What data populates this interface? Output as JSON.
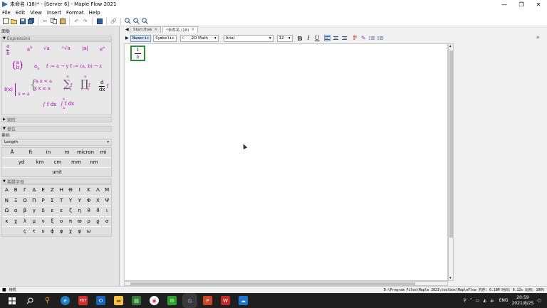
{
  "window": {
    "title": "未命名 (18)* - [Server 6] - Maple Flow 2021",
    "minimize": "—",
    "maximize": "❐",
    "close": "✕"
  },
  "menu": [
    "File",
    "Edit",
    "View",
    "Insert",
    "Format",
    "Help"
  ],
  "left_panel": {
    "header": "面板",
    "expression_title": "Expression",
    "expressions": {
      "frac_num": "a",
      "frac_den": "b",
      "power": "a",
      "power_sup": "b",
      "sqrt": "√a",
      "nroot": "ⁿ√a",
      "abs": "|a|",
      "exp": "e",
      "exp_sup": "a",
      "binom_top": "a",
      "binom_bot": "b",
      "subscript": "a",
      "subscript_sub": "n",
      "func_def": "f := a → y  f := (a, b) → z",
      "func_call": "f(x)",
      "eval_bar": "x = a",
      "piecewise_1": "-x   x < a",
      "piecewise_2": "x    x ≥ a",
      "sum": "∑",
      "sum_top": "n",
      "sum_bot": "i = k",
      "sum_body": "f",
      "prod": "∏",
      "prod_top": "n",
      "prod_bot": "i = k",
      "prod_body": "f",
      "diff_num": "d",
      "diff_den": "dx",
      "diff_body": "f",
      "int_indef": "∫ f dx",
      "int_def": "∫ f dx",
      "int_def_top": "b",
      "int_def_bot": "a"
    },
    "section_collapsed": "矩阵",
    "units_title": "单位",
    "units_label": "量纲:",
    "units_select": "Length",
    "units_row1": [
      "Å",
      "ft",
      "in",
      "m",
      "micron",
      "mi"
    ],
    "units_row2": [
      "yd",
      "km",
      "cm",
      "mm",
      "nm"
    ],
    "units_row3": [
      "unit"
    ],
    "greek_title": "希腊字母",
    "greek_rows": [
      [
        "A",
        "B",
        "Γ",
        "Δ",
        "E",
        "Z",
        "H",
        "Θ",
        "I",
        "K",
        "Λ",
        "M"
      ],
      [
        "N",
        "Ξ",
        "O",
        "Π",
        "P",
        "Σ",
        "T",
        "Υ",
        "Υ",
        "Φ",
        "X",
        "Ψ"
      ],
      [
        "Ω",
        "α",
        "β",
        "γ",
        "δ",
        "ε",
        "ε",
        "ζ",
        "η",
        "θ",
        "ϑ",
        "ι"
      ],
      [
        "κ",
        "χ",
        "λ",
        "μ",
        "ν",
        "ξ",
        "o",
        "π",
        "ϖ",
        "ρ",
        "ϱ",
        "σ"
      ],
      [
        "ς",
        "τ",
        "υ",
        "ϕ",
        "φ",
        "χ",
        "ψ",
        "ω"
      ]
    ]
  },
  "tabs": [
    {
      "label": "Start.flow",
      "close": "✕"
    },
    {
      "label": "*未命名 (18)",
      "close": "✕"
    }
  ],
  "format_bar": {
    "numeric": "Numeric",
    "symbolic": "Symbolic",
    "mode": "2D Math",
    "font": "Arial",
    "size": "12",
    "bold": "B",
    "italic": "I",
    "underline": "U"
  },
  "worksheet": {
    "math_num": "1",
    "math_den": "b"
  },
  "status": {
    "left": "待机",
    "right": "D:\\Program Files\\Maple 2021\\toolbox\\MapleFlow  内存: 6.18M  时间: 0.12s  比例: 100%"
  },
  "taskbar": {
    "lang": "ENG",
    "time": "20:59",
    "date": "2021/8/25"
  },
  "colors": {
    "accent_green": "#2f8a3c",
    "math_magenta": "#b000b0",
    "taskbar": "#1f1f1f"
  }
}
